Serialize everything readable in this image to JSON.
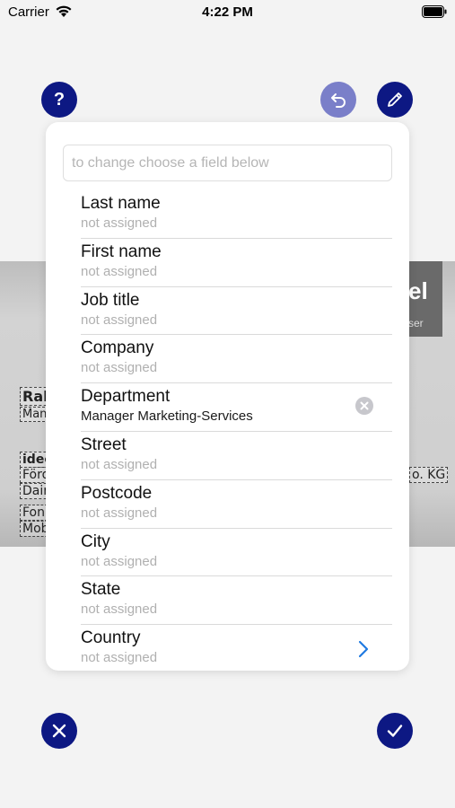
{
  "status_bar": {
    "carrier": "Carrier",
    "time": "4:22 PM"
  },
  "search": {
    "placeholder": "to change choose a field below"
  },
  "fields": [
    {
      "label": "Last name",
      "value": "not assigned"
    },
    {
      "label": "First name",
      "value": "not assigned"
    },
    {
      "label": "Job title",
      "value": "not assigned"
    },
    {
      "label": "Company",
      "value": "not assigned"
    },
    {
      "label": "Department",
      "value": "Manager Marketing-Services"
    },
    {
      "label": "Street",
      "value": "not assigned"
    },
    {
      "label": "Postcode",
      "value": "not assigned"
    },
    {
      "label": "City",
      "value": "not assigned"
    },
    {
      "label": "State",
      "value": "not assigned"
    },
    {
      "label": "Country",
      "value": "not assigned"
    }
  ],
  "scan_fragments": {
    "logo": "el",
    "logo_sub": "ser",
    "name": "Ral",
    "title": "Man",
    "company": "idee",
    "street": "Förd",
    "city": "Dair",
    "phone": "Fon",
    "mobile": "Mob",
    "company_suffix": "o. KG"
  },
  "icons": {
    "help": "help-icon",
    "undo": "undo-icon",
    "edit": "pencil-icon",
    "cancel": "close-icon",
    "confirm": "checkmark-icon",
    "clear": "clear-icon",
    "chevron": "chevron-right-icon"
  },
  "colors": {
    "primary": "#0d1883",
    "disabled_primary": "#7a7fc9",
    "link": "#1f7ae0"
  }
}
